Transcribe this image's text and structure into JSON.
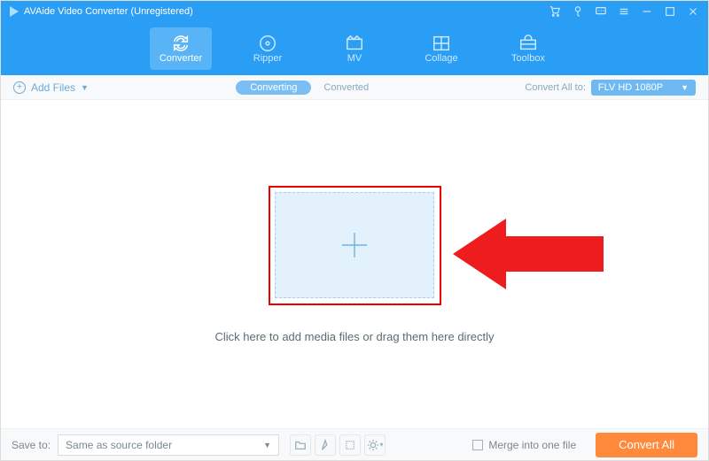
{
  "window": {
    "title": "AVAide Video Converter (Unregistered)"
  },
  "nav": {
    "items": [
      {
        "label": "Converter",
        "active": true
      },
      {
        "label": "Ripper"
      },
      {
        "label": "MV"
      },
      {
        "label": "Collage"
      },
      {
        "label": "Toolbox"
      }
    ]
  },
  "toolbar": {
    "add_files": "Add Files",
    "tab_converting": "Converting",
    "tab_converted": "Converted",
    "convert_all_label": "Convert All to:",
    "format": "FLV HD 1080P"
  },
  "content": {
    "drop_text": "Click here to add media files or drag them here directly"
  },
  "statusbar": {
    "saveto_label": "Save to:",
    "saveto_value": "Same as source folder",
    "merge_label": "Merge into one file",
    "convert_button": "Convert All"
  }
}
